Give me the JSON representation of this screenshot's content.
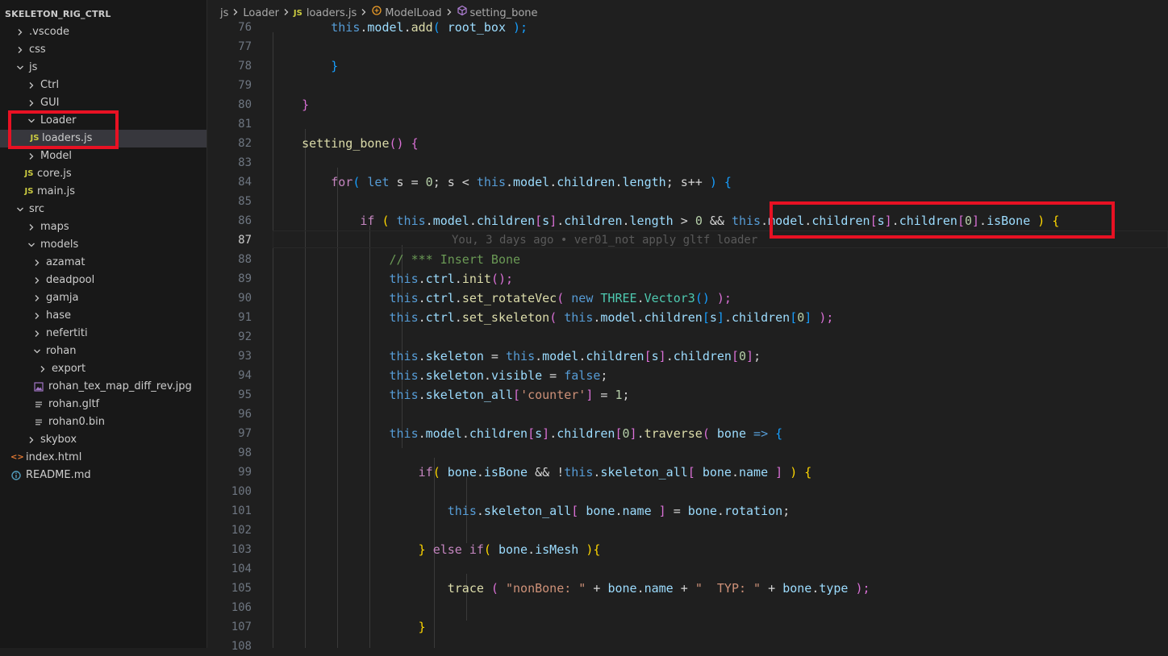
{
  "explorer": {
    "root_title": "SKELETON_RIG_CTRL",
    "items": [
      {
        "label": ".vscode",
        "type": "folder",
        "expanded": false,
        "depth": 0
      },
      {
        "label": "css",
        "type": "folder",
        "expanded": false,
        "depth": 0
      },
      {
        "label": "js",
        "type": "folder",
        "expanded": true,
        "depth": 0
      },
      {
        "label": "Ctrl",
        "type": "folder",
        "expanded": false,
        "depth": 1
      },
      {
        "label": "GUI",
        "type": "folder",
        "expanded": false,
        "depth": 1
      },
      {
        "label": "Loader",
        "type": "folder",
        "expanded": true,
        "depth": 1
      },
      {
        "label": "loaders.js",
        "type": "js",
        "depth": 2,
        "selected": true
      },
      {
        "label": "Model",
        "type": "folder",
        "expanded": false,
        "depth": 1
      },
      {
        "label": "core.js",
        "type": "js",
        "depth": 1
      },
      {
        "label": "main.js",
        "type": "js",
        "depth": 1
      },
      {
        "label": "src",
        "type": "folder",
        "expanded": true,
        "depth": 0
      },
      {
        "label": "maps",
        "type": "folder",
        "expanded": false,
        "depth": 1
      },
      {
        "label": "models",
        "type": "folder",
        "expanded": true,
        "depth": 1
      },
      {
        "label": "azamat",
        "type": "folder",
        "expanded": false,
        "depth": 2
      },
      {
        "label": "deadpool",
        "type": "folder",
        "expanded": false,
        "depth": 2
      },
      {
        "label": "gamja",
        "type": "folder",
        "expanded": false,
        "depth": 2
      },
      {
        "label": "hase",
        "type": "folder",
        "expanded": false,
        "depth": 2
      },
      {
        "label": "nefertiti",
        "type": "folder",
        "expanded": false,
        "depth": 2
      },
      {
        "label": "rohan",
        "type": "folder",
        "expanded": true,
        "depth": 2
      },
      {
        "label": "export",
        "type": "folder",
        "expanded": false,
        "depth": 3
      },
      {
        "label": "rohan_tex_map_diff_rev.jpg",
        "type": "image",
        "depth": 3
      },
      {
        "label": "rohan.gltf",
        "type": "text",
        "depth": 3
      },
      {
        "label": "rohan0.bin",
        "type": "text",
        "depth": 3
      },
      {
        "label": "skybox",
        "type": "folder",
        "expanded": false,
        "depth": 1
      },
      {
        "label": "index.html",
        "type": "html",
        "depth": 0
      },
      {
        "label": "README.md",
        "type": "info",
        "depth": 0
      }
    ]
  },
  "breadcrumb": {
    "parts": [
      "js",
      "Loader",
      "loaders.js",
      "ModelLoad",
      "setting_bone"
    ],
    "js_badge": "JS"
  },
  "editor": {
    "active_line": 87,
    "blame": "You, 3 days ago • ver01_not apply gltf loader",
    "lines": [
      {
        "n": 76,
        "t": [
          [
            "        ",
            ""
          ],
          [
            "this",
            "this"
          ],
          [
            ".",
            "op"
          ],
          [
            "model",
            "prop"
          ],
          [
            ".",
            "op"
          ],
          [
            "add",
            "fn"
          ],
          [
            "( ",
            "b3"
          ],
          [
            "root_box",
            "prop"
          ],
          [
            " );",
            "b3"
          ]
        ]
      },
      {
        "n": 77,
        "t": []
      },
      {
        "n": 78,
        "t": [
          [
            "        ",
            ""
          ],
          [
            "}",
            "b3"
          ]
        ]
      },
      {
        "n": 79,
        "t": []
      },
      {
        "n": 80,
        "t": [
          [
            "    ",
            ""
          ],
          [
            "}",
            "b2"
          ]
        ]
      },
      {
        "n": 81,
        "t": []
      },
      {
        "n": 82,
        "t": [
          [
            "    ",
            ""
          ],
          [
            "setting_bone",
            "fn"
          ],
          [
            "() ",
            "b2"
          ],
          [
            "{",
            "b2"
          ]
        ]
      },
      {
        "n": 83,
        "t": []
      },
      {
        "n": 84,
        "t": [
          [
            "        ",
            ""
          ],
          [
            "for",
            "ctl"
          ],
          [
            "( ",
            "b3"
          ],
          [
            "let",
            "kw"
          ],
          [
            " s = ",
            "txt"
          ],
          [
            "0",
            "num"
          ],
          [
            "; s < ",
            "txt"
          ],
          [
            "this",
            "this"
          ],
          [
            ".",
            "op"
          ],
          [
            "model",
            "prop"
          ],
          [
            ".",
            "op"
          ],
          [
            "children",
            "prop"
          ],
          [
            ".",
            "op"
          ],
          [
            "length",
            "prop"
          ],
          [
            "; s++ ",
            "txt"
          ],
          [
            ")",
            "b3"
          ],
          [
            " {",
            "b3"
          ]
        ]
      },
      {
        "n": 85,
        "t": []
      },
      {
        "n": 86,
        "t": [
          [
            "            ",
            ""
          ],
          [
            "if",
            "ctl"
          ],
          [
            " ( ",
            "b1"
          ],
          [
            "this",
            "this"
          ],
          [
            ".",
            "op"
          ],
          [
            "model",
            "prop"
          ],
          [
            ".",
            "op"
          ],
          [
            "children",
            "prop"
          ],
          [
            "[",
            "b2"
          ],
          [
            "s",
            "prop"
          ],
          [
            "]",
            "b2"
          ],
          [
            ".",
            "op"
          ],
          [
            "children",
            "prop"
          ],
          [
            ".",
            "op"
          ],
          [
            "length",
            "prop"
          ],
          [
            " > ",
            "txt"
          ],
          [
            "0",
            "num"
          ],
          [
            " && ",
            "txt"
          ],
          [
            "this",
            "this"
          ],
          [
            ".",
            "op"
          ],
          [
            "model",
            "prop"
          ],
          [
            ".",
            "op"
          ],
          [
            "children",
            "prop"
          ],
          [
            "[",
            "b2"
          ],
          [
            "s",
            "prop"
          ],
          [
            "]",
            "b2"
          ],
          [
            ".",
            "op"
          ],
          [
            "children",
            "prop"
          ],
          [
            "[",
            "b2"
          ],
          [
            "0",
            "num"
          ],
          [
            "]",
            "b2"
          ],
          [
            ".",
            "op"
          ],
          [
            "isBone",
            "prop"
          ],
          [
            " ) ",
            "b1"
          ],
          [
            "{",
            "b1"
          ]
        ]
      },
      {
        "n": 87,
        "t": []
      },
      {
        "n": 88,
        "t": [
          [
            "                ",
            ""
          ],
          [
            "// *** Insert Bone",
            "cmt"
          ]
        ]
      },
      {
        "n": 89,
        "t": [
          [
            "                ",
            ""
          ],
          [
            "this",
            "this"
          ],
          [
            ".",
            "op"
          ],
          [
            "ctrl",
            "prop"
          ],
          [
            ".",
            "op"
          ],
          [
            "init",
            "fn"
          ],
          [
            "();",
            "b2"
          ]
        ]
      },
      {
        "n": 90,
        "t": [
          [
            "                ",
            ""
          ],
          [
            "this",
            "this"
          ],
          [
            ".",
            "op"
          ],
          [
            "ctrl",
            "prop"
          ],
          [
            ".",
            "op"
          ],
          [
            "set_rotateVec",
            "fn"
          ],
          [
            "( ",
            "b2"
          ],
          [
            "new",
            "kw"
          ],
          [
            " ",
            ""
          ],
          [
            "THREE",
            "cls"
          ],
          [
            ".",
            "op"
          ],
          [
            "Vector3",
            "cls"
          ],
          [
            "()",
            "b3"
          ],
          [
            " );",
            "b2"
          ]
        ]
      },
      {
        "n": 91,
        "t": [
          [
            "                ",
            ""
          ],
          [
            "this",
            "this"
          ],
          [
            ".",
            "op"
          ],
          [
            "ctrl",
            "prop"
          ],
          [
            ".",
            "op"
          ],
          [
            "set_skeleton",
            "fn"
          ],
          [
            "( ",
            "b2"
          ],
          [
            "this",
            "this"
          ],
          [
            ".",
            "op"
          ],
          [
            "model",
            "prop"
          ],
          [
            ".",
            "op"
          ],
          [
            "children",
            "prop"
          ],
          [
            "[",
            "b3"
          ],
          [
            "s",
            "prop"
          ],
          [
            "]",
            "b3"
          ],
          [
            ".",
            "op"
          ],
          [
            "children",
            "prop"
          ],
          [
            "[",
            "b3"
          ],
          [
            "0",
            "num"
          ],
          [
            "]",
            "b3"
          ],
          [
            " );",
            "b2"
          ]
        ]
      },
      {
        "n": 92,
        "t": []
      },
      {
        "n": 93,
        "t": [
          [
            "                ",
            ""
          ],
          [
            "this",
            "this"
          ],
          [
            ".",
            "op"
          ],
          [
            "skeleton",
            "prop"
          ],
          [
            " = ",
            "txt"
          ],
          [
            "this",
            "this"
          ],
          [
            ".",
            "op"
          ],
          [
            "model",
            "prop"
          ],
          [
            ".",
            "op"
          ],
          [
            "children",
            "prop"
          ],
          [
            "[",
            "b2"
          ],
          [
            "s",
            "prop"
          ],
          [
            "]",
            "b2"
          ],
          [
            ".",
            "op"
          ],
          [
            "children",
            "prop"
          ],
          [
            "[",
            "b2"
          ],
          [
            "0",
            "num"
          ],
          [
            "]",
            "b2"
          ],
          [
            ";",
            "txt"
          ]
        ]
      },
      {
        "n": 94,
        "t": [
          [
            "                ",
            ""
          ],
          [
            "this",
            "this"
          ],
          [
            ".",
            "op"
          ],
          [
            "skeleton",
            "prop"
          ],
          [
            ".",
            "op"
          ],
          [
            "visible",
            "prop"
          ],
          [
            " = ",
            "txt"
          ],
          [
            "false",
            "kw"
          ],
          [
            ";",
            "txt"
          ]
        ]
      },
      {
        "n": 95,
        "t": [
          [
            "                ",
            ""
          ],
          [
            "this",
            "this"
          ],
          [
            ".",
            "op"
          ],
          [
            "skeleton_all",
            "prop"
          ],
          [
            "[",
            "b2"
          ],
          [
            "'counter'",
            "str"
          ],
          [
            "]",
            "b2"
          ],
          [
            " = ",
            "txt"
          ],
          [
            "1",
            "num"
          ],
          [
            ";",
            "txt"
          ]
        ]
      },
      {
        "n": 96,
        "t": []
      },
      {
        "n": 97,
        "t": [
          [
            "                ",
            ""
          ],
          [
            "this",
            "this"
          ],
          [
            ".",
            "op"
          ],
          [
            "model",
            "prop"
          ],
          [
            ".",
            "op"
          ],
          [
            "children",
            "prop"
          ],
          [
            "[",
            "b2"
          ],
          [
            "s",
            "prop"
          ],
          [
            "]",
            "b2"
          ],
          [
            ".",
            "op"
          ],
          [
            "children",
            "prop"
          ],
          [
            "[",
            "b2"
          ],
          [
            "0",
            "num"
          ],
          [
            "]",
            "b2"
          ],
          [
            ".",
            "op"
          ],
          [
            "traverse",
            "fn"
          ],
          [
            "( ",
            "b2"
          ],
          [
            "bone",
            "prop"
          ],
          [
            " => ",
            "kw"
          ],
          [
            "{",
            "b3"
          ]
        ]
      },
      {
        "n": 98,
        "t": []
      },
      {
        "n": 99,
        "t": [
          [
            "                    ",
            ""
          ],
          [
            "if",
            "ctl"
          ],
          [
            "( ",
            "b1"
          ],
          [
            "bone",
            "prop"
          ],
          [
            ".",
            "op"
          ],
          [
            "isBone",
            "prop"
          ],
          [
            " && !",
            "txt"
          ],
          [
            "this",
            "this"
          ],
          [
            ".",
            "op"
          ],
          [
            "skeleton_all",
            "prop"
          ],
          [
            "[ ",
            "b2"
          ],
          [
            "bone",
            "prop"
          ],
          [
            ".",
            "op"
          ],
          [
            "name",
            "prop"
          ],
          [
            " ]",
            "b2"
          ],
          [
            " ) ",
            "b1"
          ],
          [
            "{",
            "b1"
          ]
        ]
      },
      {
        "n": 100,
        "t": []
      },
      {
        "n": 101,
        "t": [
          [
            "                        ",
            ""
          ],
          [
            "this",
            "this"
          ],
          [
            ".",
            "op"
          ],
          [
            "skeleton_all",
            "prop"
          ],
          [
            "[ ",
            "b2"
          ],
          [
            "bone",
            "prop"
          ],
          [
            ".",
            "op"
          ],
          [
            "name",
            "prop"
          ],
          [
            " ]",
            "b2"
          ],
          [
            " = ",
            "txt"
          ],
          [
            "bone",
            "prop"
          ],
          [
            ".",
            "op"
          ],
          [
            "rotation",
            "prop"
          ],
          [
            ";",
            "txt"
          ]
        ]
      },
      {
        "n": 102,
        "t": []
      },
      {
        "n": 103,
        "t": [
          [
            "                    ",
            ""
          ],
          [
            "}",
            "b1"
          ],
          [
            " ",
            ""
          ],
          [
            "else",
            "ctl"
          ],
          [
            " ",
            ""
          ],
          [
            "if",
            "ctl"
          ],
          [
            "( ",
            "b1"
          ],
          [
            "bone",
            "prop"
          ],
          [
            ".",
            "op"
          ],
          [
            "isMesh",
            "prop"
          ],
          [
            " )",
            "b1"
          ],
          [
            "{",
            "b1"
          ]
        ]
      },
      {
        "n": 104,
        "t": []
      },
      {
        "n": 105,
        "t": [
          [
            "                        ",
            ""
          ],
          [
            "trace",
            "fn"
          ],
          [
            " ( ",
            "b2"
          ],
          [
            "\"nonBone: \"",
            "str"
          ],
          [
            " + ",
            "txt"
          ],
          [
            "bone",
            "prop"
          ],
          [
            ".",
            "op"
          ],
          [
            "name",
            "prop"
          ],
          [
            " + ",
            "txt"
          ],
          [
            "\"  TYP: \"",
            "str"
          ],
          [
            " + ",
            "txt"
          ],
          [
            "bone",
            "prop"
          ],
          [
            ".",
            "op"
          ],
          [
            "type",
            "prop"
          ],
          [
            " );",
            "b2"
          ]
        ]
      },
      {
        "n": 106,
        "t": []
      },
      {
        "n": 107,
        "t": [
          [
            "                    ",
            ""
          ],
          [
            "}",
            "b1"
          ]
        ]
      },
      {
        "n": 108,
        "t": []
      }
    ]
  }
}
